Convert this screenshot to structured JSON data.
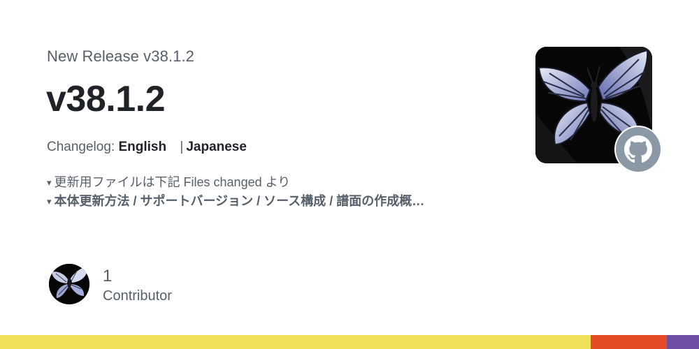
{
  "header": {
    "eyebrow": "New Release v38.1.2",
    "title": "v38.1.2"
  },
  "changelog": {
    "label": "Changelog:",
    "links": [
      "English",
      "Japanese"
    ],
    "separator": "|"
  },
  "description": {
    "line1": "更新用ファイルは下記 Files changed より",
    "line2": "本体更新方法 / サポートバージョン / ソース構成 / 譜面の作成概…",
    "marker": "▾"
  },
  "contributors": {
    "count": "1",
    "label": "Contributor"
  },
  "icons": {
    "repo_image": "butterfly-image",
    "badge": "github-icon",
    "avatar": "butterfly-avatar"
  },
  "colors": {
    "text_primary": "#1f2328",
    "text_secondary": "#57606a",
    "badge_gray": "#8b99a7"
  },
  "language_bar": [
    {
      "color": "#f1e05a",
      "percent": 84.5
    },
    {
      "color": "#e34c26",
      "percent": 10.9
    },
    {
      "color": "#6e4fa6",
      "percent": 4.6
    }
  ]
}
